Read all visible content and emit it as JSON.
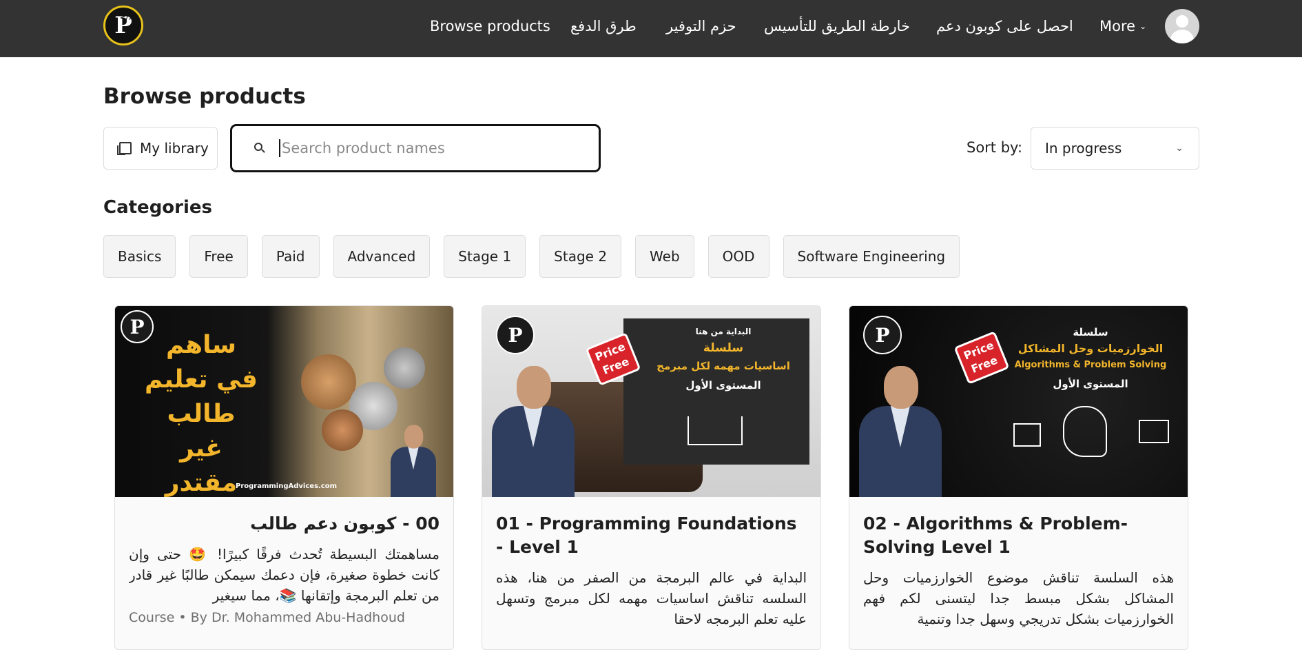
{
  "header": {
    "logo_letter": "P",
    "nav": [
      {
        "label": "Browse products"
      },
      {
        "label": "طرق الدفع"
      },
      {
        "label": "حزم التوفير"
      },
      {
        "label": "خارطة الطريق للتأسيس"
      },
      {
        "label": "احصل على كوبون دعم"
      },
      {
        "label": "More"
      }
    ]
  },
  "page": {
    "title": "Browse products"
  },
  "toolbar": {
    "library_label": "My library",
    "search_placeholder": "Search product names",
    "search_value": "",
    "sort_label": "Sort by:",
    "sort_value": "In progress"
  },
  "categories": {
    "title": "Categories",
    "items": [
      "Basics",
      "Free",
      "Paid",
      "Advanced",
      "Stage 1",
      "Stage 2",
      "Web",
      "OOD",
      "Software Engineering"
    ]
  },
  "cards": [
    {
      "title": "00 - كوبون دعم طالب",
      "description": "مساهمتك البسيطة تُحدث فرقًا كبيرًا! 🤩 حتى وإن كانت خطوة صغيرة، فإن دعمك سيمكن طالبًا غير قادر من تعلم البرمجة وإتقانها 📚، مما سيغير",
      "meta": "Course • By Dr. Mohammed Abu-Hadhoud",
      "thumb_text": [
        "ساهم",
        "في تعليم",
        "طالب غير",
        "مقتدر"
      ],
      "thumb_footer": "ProgrammingAdvices.com"
    },
    {
      "title": "01 - Programming Foundations - Level 1",
      "description": "البداية في عالم البرمجة من الصفر من هنا، هذه السلسه تناقش اساسيات مهمه لكل مبرمج وتسهل عليه تعلم البرمجه لاحقا",
      "thumb_text": [
        "البداية من هنا",
        "سلسلة",
        "اساسيات مهمه لكل مبرمج",
        "المستوى الأول"
      ],
      "price_tag": [
        "Price",
        "Free"
      ]
    },
    {
      "title": "02 - Algorithms & Problem-Solving Level 1",
      "description": "هذه السلسة تناقش موضوع الخوارزميات وحل المشاكل بشكل مبسط جدا ليتسنى لكم فهم الخوارزميات بشكل تدريجي وسهل جدا وتنمية",
      "thumb_text": [
        "سلسلة",
        "الخوارزميات وحل المشاكل",
        "Algorithms & Problem Solving",
        "المستوى الأول"
      ],
      "price_tag": [
        "Price",
        "Free"
      ]
    }
  ],
  "colors": {
    "header_bg": "#333333",
    "logo_ring": "#e8c21b",
    "thumb_gold": "#f2b52b",
    "price_red": "#d8232a"
  }
}
